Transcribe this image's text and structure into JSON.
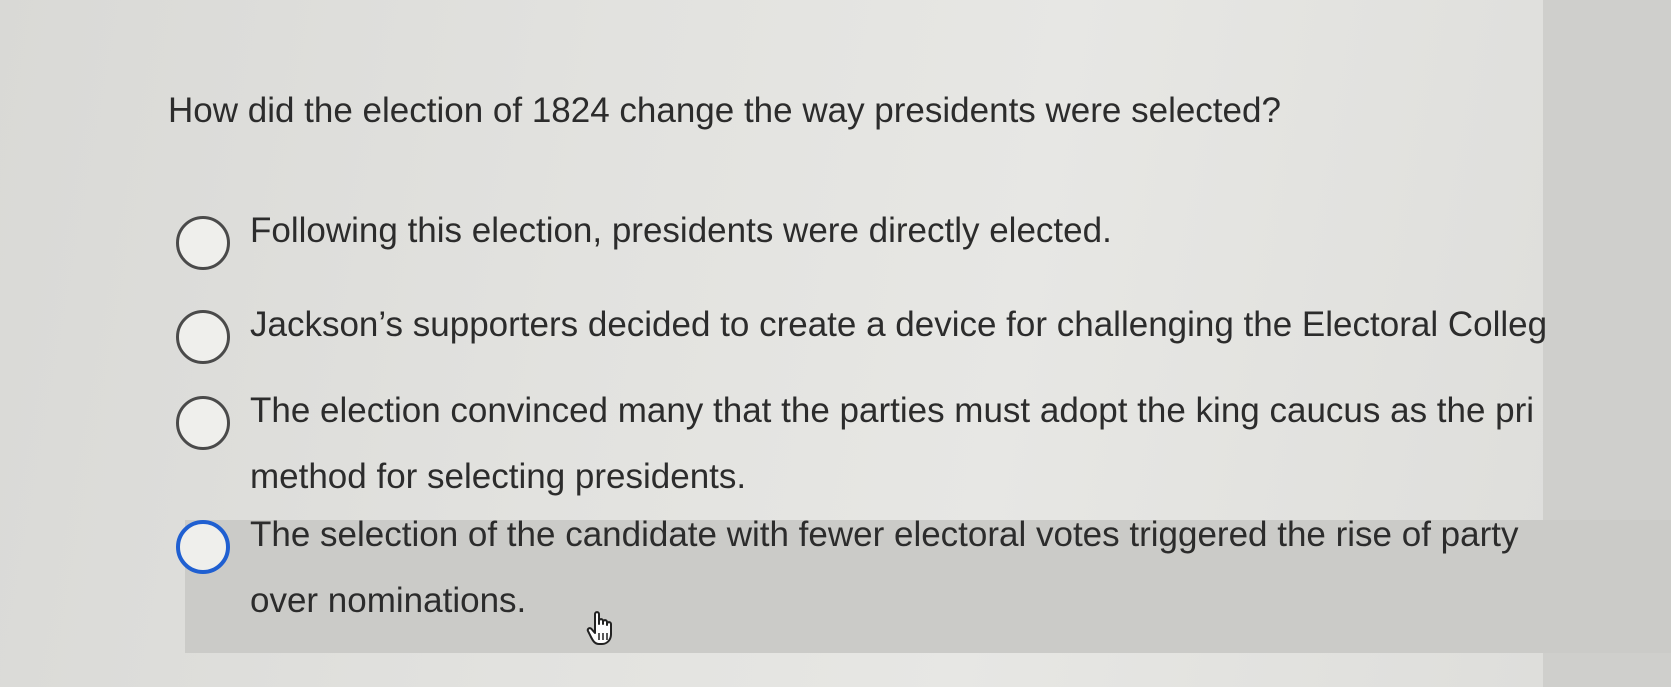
{
  "question": {
    "text": "How did the election of 1824 change the way presidents were selected?"
  },
  "options": [
    {
      "label": "Following this election, presidents were directly elected."
    },
    {
      "label": "Jackson’s supporters decided to create a device for challenging the Electoral Colleg"
    },
    {
      "label_line1": "The election convinced many that the parties must adopt the king caucus as the pri",
      "label_line2": "method for selecting presidents."
    },
    {
      "label_line1": "The selection of the candidate with fewer electoral votes triggered the rise of party",
      "label_line2": "over nominations."
    }
  ],
  "icons": {
    "radio": "radio-button-icon",
    "cursor": "hand-cursor-icon"
  },
  "colors": {
    "focus_radio": "#1f5fd1",
    "hover_row": "#cbcbc8"
  }
}
